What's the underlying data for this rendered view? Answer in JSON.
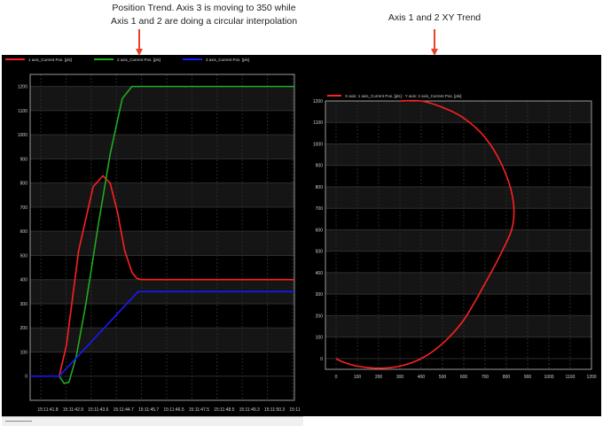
{
  "captions": {
    "left_line1": "Position Trend.  Axis 3 is moving to 350 while",
    "left_line2": "Axis 1 and 2 are doing a circular interpolation",
    "right": "Axis 1 and 2 XY Trend"
  },
  "colors": {
    "axis1": "#ff2020",
    "axis2": "#22aa22",
    "axis3": "#1a1aff",
    "arrow": "#e8402a"
  },
  "chart_data": [
    {
      "type": "line",
      "legend": [
        "1 axis_Current Pos. [pls]",
        "2 axis_Current Pos. [pls]",
        "3 axis_Current Pos. [pls]"
      ],
      "legend_placement": "top-left",
      "ylim": [
        -100,
        1250
      ],
      "y_ticks": [
        0,
        100,
        200,
        300,
        400,
        500,
        600,
        700,
        800,
        900,
        1000,
        1100,
        1200
      ],
      "x_tick_labels": [
        "15:11:41.8",
        "15:11:42.9",
        "15:11:43.6",
        "15:11:44.7",
        "15:11:45.7",
        "15:11:46.5",
        "15:11:47.5",
        "15:11:48.5",
        "15:11:49.3",
        "15:11:50.3",
        "15:11:51.4"
      ],
      "xlim": [
        0,
        10.9
      ],
      "grid": true,
      "series": [
        {
          "name": "1 axis_Current Pos. [pls]",
          "x": [
            0,
            1.2,
            1.5,
            2.0,
            2.6,
            3.0,
            3.3,
            3.6,
            3.9,
            4.2,
            4.4,
            4.6,
            10.9
          ],
          "values": [
            0,
            0,
            130,
            520,
            785,
            830,
            800,
            680,
            520,
            430,
            405,
            400,
            400
          ]
        },
        {
          "name": "2 axis_Current Pos. [pls]",
          "x": [
            0,
            1.2,
            1.4,
            1.6,
            1.9,
            2.3,
            2.8,
            3.3,
            3.8,
            4.2,
            4.45,
            10.9
          ],
          "values": [
            0,
            0,
            -30,
            -25,
            80,
            300,
            620,
            920,
            1150,
            1200,
            1200,
            1200
          ]
        },
        {
          "name": "3 axis_Current Pos. [pls]",
          "x": [
            0,
            1.2,
            4.45,
            10.9
          ],
          "values": [
            0,
            0,
            350,
            350
          ]
        }
      ]
    },
    {
      "type": "scatter",
      "legend": [
        "X axis: 1 axis_Current Pos. [pls] - Y axis: 2 axis_Current Pos. [pls]"
      ],
      "legend_placement": "top-left",
      "xlim": [
        -50,
        1200
      ],
      "ylim": [
        -50,
        1200
      ],
      "x_ticks": [
        0,
        100,
        200,
        300,
        400,
        500,
        600,
        700,
        800,
        900,
        1000,
        1100,
        1200
      ],
      "y_ticks": [
        0,
        100,
        200,
        300,
        400,
        500,
        600,
        700,
        800,
        900,
        1000,
        1100,
        1200
      ],
      "grid": true,
      "series": [
        {
          "name": "X axis: 1 axis_Current Pos. [pls] - Y axis: 2 axis_Current Pos. [pls]",
          "x": [
            0,
            30,
            100,
            200,
            300,
            400,
            500,
            600,
            700,
            780,
            830,
            830,
            780,
            700,
            600,
            500,
            400,
            300
          ],
          "values": [
            0,
            -15,
            -35,
            -45,
            -35,
            0,
            70,
            180,
            350,
            500,
            620,
            750,
            900,
            1030,
            1120,
            1170,
            1200,
            1200
          ]
        }
      ]
    }
  ]
}
